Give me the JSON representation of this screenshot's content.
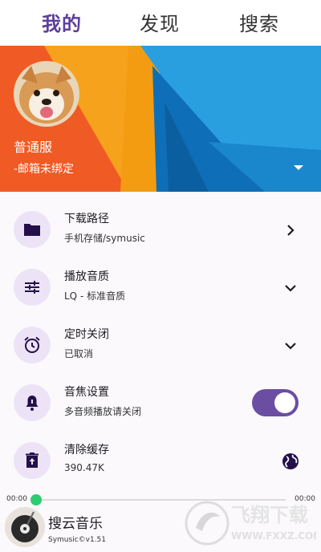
{
  "tabs": [
    "我的",
    "发现",
    "搜索"
  ],
  "profile": {
    "name": "普通服",
    "email": "-邮箱未绑定"
  },
  "settings": [
    {
      "title": "下载路径",
      "sub": "手机存储/symusic",
      "icon": "folder-icon",
      "trail": "chevron-right-icon"
    },
    {
      "title": "播放音质",
      "sub": "LQ - 标准音质",
      "icon": "tune-icon",
      "trail": "chevron-down-icon"
    },
    {
      "title": "定时关闭",
      "sub": "已取消",
      "icon": "alarm-icon",
      "trail": "chevron-down-icon"
    },
    {
      "title": "音焦设置",
      "sub": "多音频播放请关闭",
      "icon": "bell-icon",
      "trail": "toggle-switch",
      "toggle_on": true
    },
    {
      "title": "清除缓存",
      "sub": "390.47K",
      "icon": "trash-icon",
      "trail": "globe-icon"
    }
  ],
  "player": {
    "current_time": "00:00",
    "total_time": "00:00",
    "progress": 0,
    "title": "搜云音乐",
    "subtitle": "Symusic©v1.51"
  },
  "watermark": {
    "text": "飞翔下载",
    "url": "WWW.FXXZ.COM"
  },
  "colors": {
    "accent": "#5d3f9a",
    "icon_bg": "#ece4f6",
    "progress_thumb": "#2ecc71"
  }
}
